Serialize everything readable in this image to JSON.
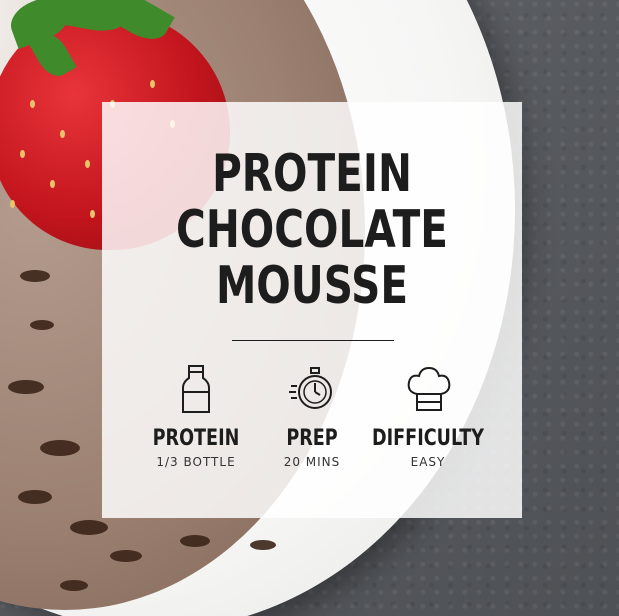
{
  "title_lines": [
    "PROTEIN",
    "CHOCOLATE",
    "MOUSSE"
  ],
  "stats": [
    {
      "icon": "bottle-icon",
      "label": "PROTEIN",
      "value": "1/3 BOTTLE"
    },
    {
      "icon": "stopwatch-icon",
      "label": "PREP",
      "value": "20 MINS"
    },
    {
      "icon": "chef-hat-icon",
      "label": "DIFFICULTY",
      "value": "EASY"
    }
  ],
  "colors": {
    "card": "#ffffff",
    "text": "#1d1d1d",
    "strawberry": "#c3151d",
    "background": "#585b60"
  }
}
